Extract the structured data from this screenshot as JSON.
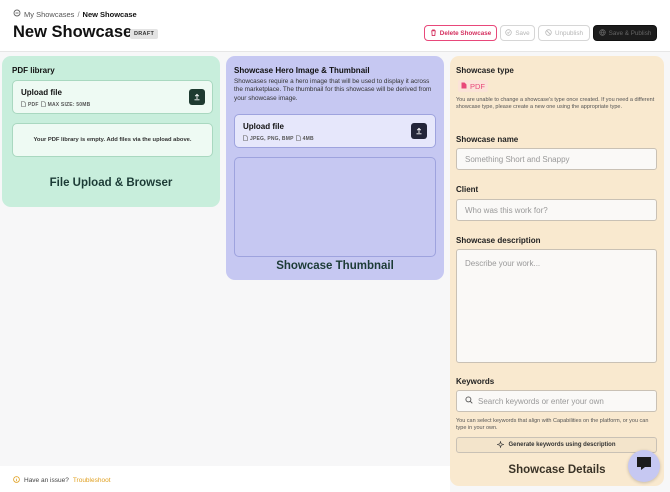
{
  "breadcrumb": {
    "parent": "My Showcases",
    "separator": "/",
    "current": "New Showcase"
  },
  "page": {
    "title": "New Showcase",
    "status_badge": "DRAFT"
  },
  "toolbar": {
    "delete_label": "Delete Showcase",
    "save_label": "Save",
    "unpublish_label": "Unpublish",
    "publish_label": "Save & Publish"
  },
  "pdf_library": {
    "title": "PDF library",
    "upload_title": "Upload file",
    "upload_type": "PDF",
    "upload_max": "MAX SIZE: 50MB",
    "empty_message": "Your PDF library is empty. Add files via the upload above.",
    "region_label": "File Upload & Browser"
  },
  "hero": {
    "title": "Showcase Hero Image & Thumbnail",
    "description": "Showcases require a hero image that will be used to display it across the marketplace. The thumbnail for this showcase will be derived from your showcase image.",
    "upload_title": "Upload file",
    "upload_types": "JPEG, PNG, BMP",
    "upload_max": "4MB",
    "region_label": "Showcase Thumbnail"
  },
  "details": {
    "type_label": "Showcase type",
    "type_value": "PDF",
    "type_help": "You are unable to change a showcase's type once created. If you need a different showcase type, please create a new one using the appropriate type.",
    "name_label": "Showcase name",
    "name_placeholder": "Something Short and Snappy",
    "client_label": "Client",
    "client_placeholder": "Who was this work for?",
    "description_label": "Showcase description",
    "description_placeholder": "Describe your work...",
    "keywords_label": "Keywords",
    "keywords_placeholder": "Search keywords or enter your own",
    "keywords_help": "You can select keywords that align with Capabilities on the platform, or you can type in your own.",
    "generate_label": "Generate keywords using description",
    "region_label": "Showcase Details"
  },
  "footer": {
    "issue_text": "Have an issue?",
    "troubleshoot_label": "Troubleshoot"
  },
  "colors": {
    "pdf_panel": "#c8eedc",
    "hero_panel": "#c6c8f2",
    "details_panel": "#f9e9cf",
    "delete_accent": "#e8487a",
    "link_accent": "#e0a020"
  },
  "icons": [
    "folder-icon",
    "trash-icon",
    "save-icon",
    "unpublish-icon",
    "publish-icon",
    "file-icon",
    "upload-icon",
    "search-icon",
    "sparkle-icon",
    "info-icon",
    "chat-icon"
  ]
}
